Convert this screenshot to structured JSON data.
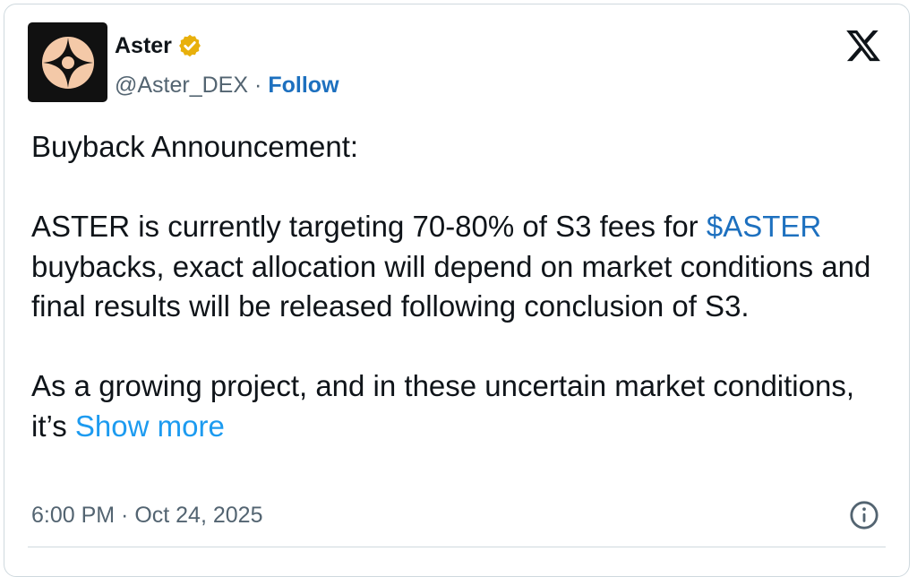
{
  "author": {
    "display_name": "Aster",
    "handle": "@Aster_DEX",
    "separator": "·",
    "follow_label": "Follow",
    "verified_color": "#e8b00c",
    "avatar_bg": "#111111",
    "avatar_mark_color": "#f4c9a8"
  },
  "tweet": {
    "line1": "Buyback Announcement:",
    "para2_before_cashtag": "ASTER is currently targeting 70-80% of S3 fees for ",
    "cashtag": "$ASTER",
    "para2_after_cashtag": " buybacks, exact allocation will depend on market conditions and final results will be released following conclusion of S3.",
    "para3": "As a growing project, and in these uncertain market conditions, it’s ",
    "show_more": "Show more"
  },
  "timestamp": "6:00 PM · Oct 24, 2025",
  "icons": {
    "platform": "x-logo-icon",
    "info": "info-icon",
    "verified": "verified-badge-icon",
    "avatar": "aster-logo-icon"
  },
  "colors": {
    "link": "#1d70bf",
    "show_more": "#1d9bf0",
    "secondary_text": "#536471",
    "border": "#cfd9de"
  }
}
